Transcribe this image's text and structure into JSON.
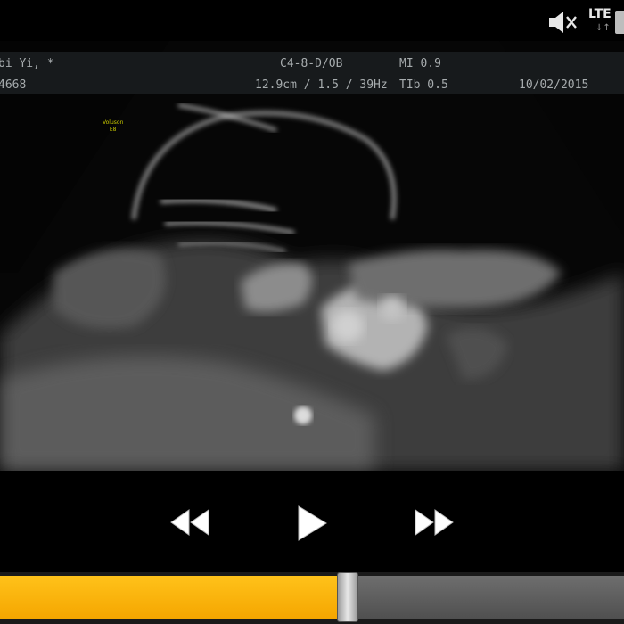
{
  "status_bar": {
    "mute_icon": "speaker-muted-icon",
    "network_label": "LTE",
    "network_arrows": "↓↑",
    "battery_icon": "battery-icon"
  },
  "ultrasound_header": {
    "patient_name": "bi Yi,  *",
    "patient_id": "4668",
    "probe_preset": "C4-8-D/OB",
    "mechanical_index": "MI  0.9",
    "depth_gain_rate": "12.9cm / 1.5 / 39Hz",
    "thermal_index": "TIb  0.5",
    "date": "10/02/2015"
  },
  "scan_overlay": {
    "marker_line1": "Voluson",
    "marker_line2": "E8"
  },
  "player": {
    "rewind_icon": "rewind-icon",
    "play_icon": "play-icon",
    "fast_forward_icon": "fast-forward-icon",
    "progress_fraction": 0.555,
    "accent_color": "#f7b500"
  }
}
